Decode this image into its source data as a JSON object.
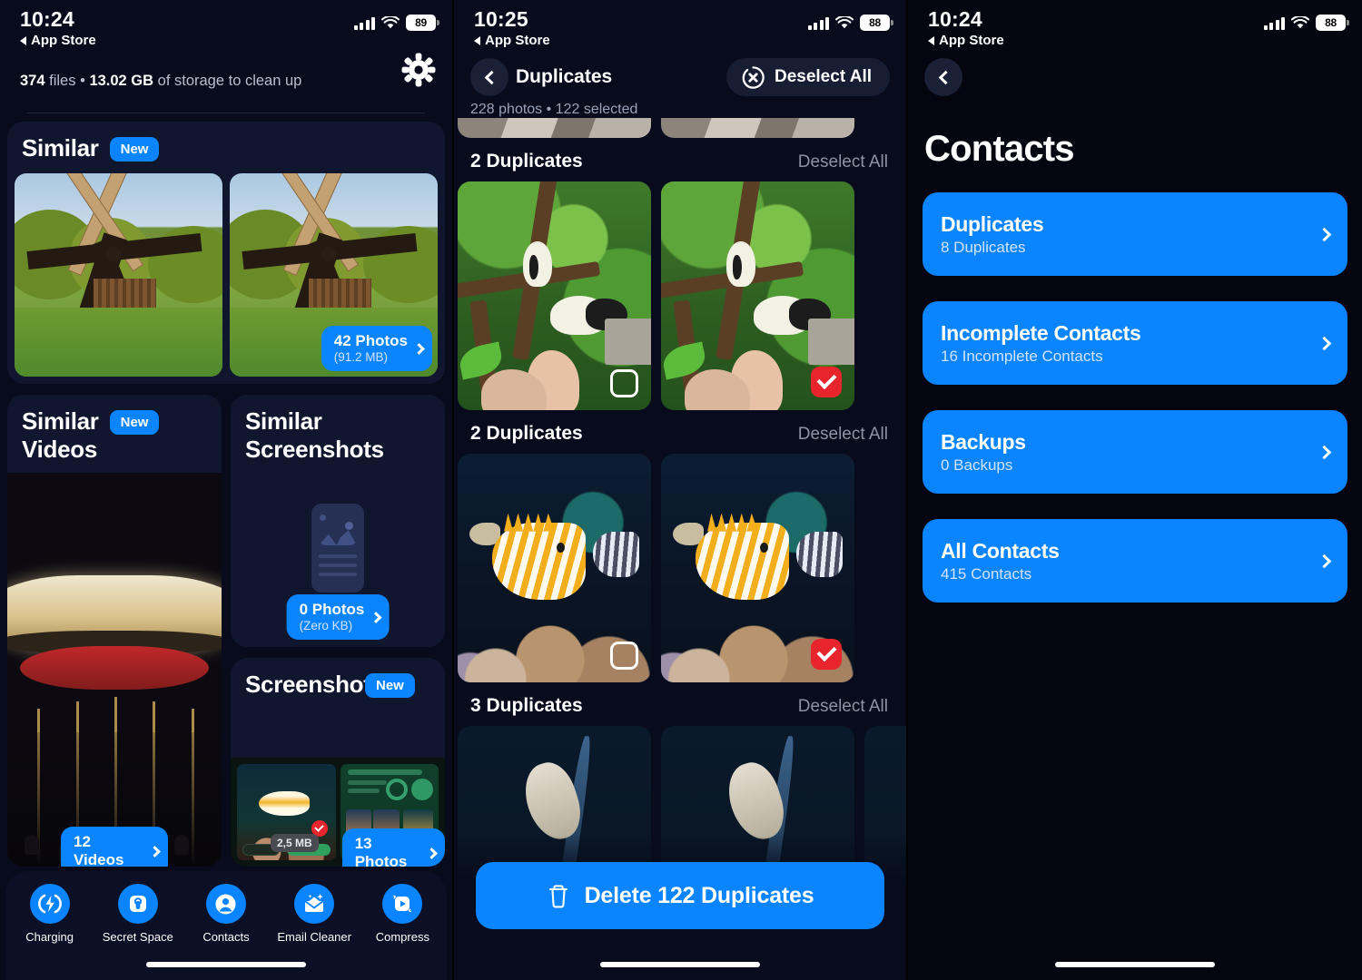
{
  "screens": [
    {
      "id": "photo-cleaner-home",
      "status": {
        "time": "10:24",
        "back_app": "App Store",
        "battery": "89"
      },
      "summary": {
        "files_count": "374",
        "files_word": "files",
        "sep": "•",
        "size": "13.02 GB",
        "tail": "of storage to clean up"
      },
      "settings_icon": "gear-icon",
      "cards": {
        "similar": {
          "title": "Similar",
          "badge": "New",
          "pill_main": "42 Photos",
          "pill_sub": "(91.2 MB)"
        },
        "similar_videos": {
          "title": "Similar\nVideos",
          "badge": "New",
          "pill_main": "12 Videos",
          "pill_sub": ""
        },
        "similar_screenshots": {
          "title": "Similar\nScreenshots",
          "badge": "",
          "pill_main": "0 Photos",
          "pill_sub": "(Zero KB)"
        },
        "screenshots": {
          "title": "Screenshots",
          "badge": "New",
          "pill_main": "13 Photos",
          "pill_sub": "",
          "size_chip": "2,5 MB"
        }
      },
      "tabs": [
        {
          "label": "Charging",
          "icon": "charging-bolt-icon"
        },
        {
          "label": "Secret Space",
          "icon": "lock-box-icon"
        },
        {
          "label": "Contacts",
          "icon": "person-circle-icon"
        },
        {
          "label": "Email Cleaner",
          "icon": "sparkle-envelope-icon"
        },
        {
          "label": "Compress",
          "icon": "play-compress-icon"
        }
      ]
    },
    {
      "id": "duplicates",
      "status": {
        "time": "10:25",
        "back_app": "App Store",
        "battery": "88"
      },
      "nav": {
        "back_icon": "chevron-left-icon",
        "title": "Duplicates",
        "action_label": "Deselect All",
        "action_icon": "circle-x-icon"
      },
      "subtitle": "228 photos • 122 selected",
      "groups": [
        {
          "title": "",
          "action": "",
          "scene": "feet",
          "thumbs": [
            {
              "selected": false
            },
            {
              "selected": true
            }
          ]
        },
        {
          "title": "2 Duplicates",
          "action": "Deselect All",
          "scene": "birds",
          "thumbs": [
            {
              "selected": false
            },
            {
              "selected": true
            }
          ]
        },
        {
          "title": "2 Duplicates",
          "action": "Deselect All",
          "scene": "aqua",
          "thumbs": [
            {
              "selected": false
            },
            {
              "selected": true
            }
          ]
        },
        {
          "title": "3 Duplicates",
          "action": "Deselect All",
          "scene": "turtle",
          "thumbs": [
            {
              "selected": false
            },
            {
              "selected": false
            },
            {
              "selected": false
            }
          ]
        }
      ],
      "delete_button": {
        "label": "Delete 122 Duplicates",
        "icon": "trash-icon"
      }
    },
    {
      "id": "contacts",
      "status": {
        "time": "10:24",
        "back_app": "App Store",
        "battery": "88"
      },
      "back_icon": "chevron-left-icon",
      "title": "Contacts",
      "items": [
        {
          "title": "Duplicates",
          "subtitle": "8 Duplicates"
        },
        {
          "title": "Incomplete Contacts",
          "subtitle": "16 Incomplete Contacts"
        },
        {
          "title": "Backups",
          "subtitle": "0 Backups"
        },
        {
          "title": "All Contacts",
          "subtitle": "415 Contacts"
        }
      ]
    }
  ],
  "colors": {
    "accent": "#0a84ff",
    "danger": "#e8242c",
    "bg": "#070b1c",
    "card": "#10162e",
    "muted": "#8d93a6"
  }
}
